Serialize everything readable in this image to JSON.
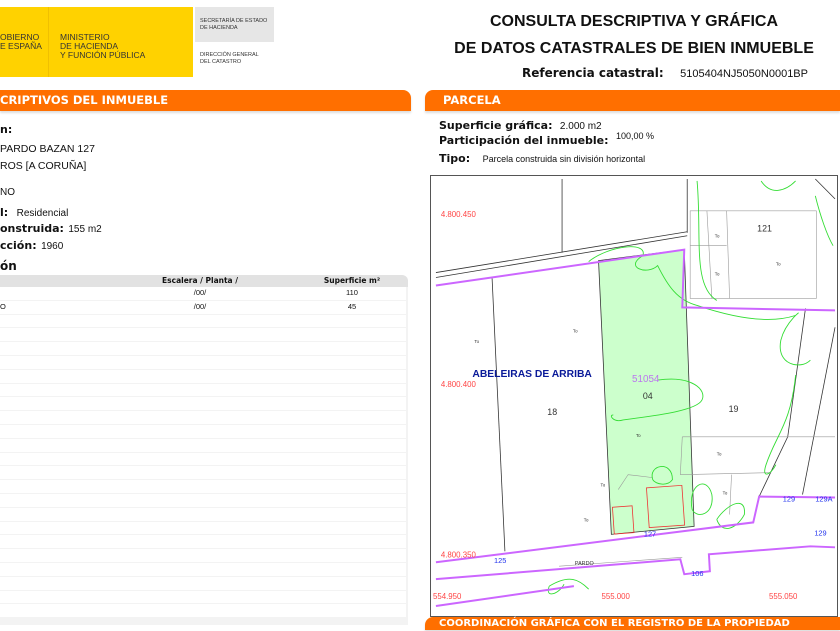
{
  "header": {
    "gov_line1": "OBIERNO",
    "gov_line2": "E ESPAÑA",
    "ministry_line1": "MINISTERIO",
    "ministry_line2": "DE HACIENDA",
    "ministry_line3": "Y FUNCIÓN PÚBLICA",
    "secretaria_line1": "SECRETARÍA DE ESTADO",
    "secretaria_line2": "DE HACIENDA",
    "direccion_line1": "DIRECCIÓN GENERAL",
    "direccion_line2": "DEL CATASTRO",
    "title_line1": "CONSULTA DESCRIPTIVA Y GRÁFICA",
    "title_line2": "DE DATOS CATASTRALES DE BIEN INMUEBLE",
    "ref_label": "Referencia catastral:",
    "ref_value": "5105404NJ5050N0001BP"
  },
  "left": {
    "section_title": "CRIPTIVOS DEL INMUEBLE",
    "loc_label": "n:",
    "address1": "PARDO BAZAN 127",
    "address2": "ROS [A CORUÑA]",
    "clase": "NO",
    "uso_label": "l:",
    "uso_value": "Residencial",
    "sup_label": "onstruida:",
    "sup_value": "155 m2",
    "anio_label": "cción:",
    "anio_value": "1960",
    "const_label": "ón",
    "table": {
      "headers": [
        "",
        "Escalera / Planta / Puerta",
        "Superficie m²"
      ],
      "rows": [
        [
          "",
          "/00/",
          "110"
        ],
        [
          "O",
          "/00/",
          "45"
        ]
      ]
    }
  },
  "right": {
    "section_title": "PARCELA",
    "sup_label": "Superficie gráfica:",
    "sup_value": "2.000 m2",
    "part_label": "Participación del inmueble:",
    "part_value": "100,00 %",
    "tipo_label": "Tipo:",
    "tipo_value": "Parcela construida sin división horizontal",
    "map": {
      "y_coords": [
        "4.800.450",
        "4.800.400",
        "4.800.350"
      ],
      "x_coords": [
        "554.950",
        "555.000",
        "555.050"
      ],
      "place": "ABELEIRAS DE ARRIBA",
      "parcel_ref": "51054",
      "parcel_num": "04",
      "parcels": [
        "121",
        "18",
        "19"
      ],
      "house_numbers": [
        "129",
        "129A",
        "129",
        "127",
        "125",
        "106"
      ],
      "street": "PARDO",
      "to_label": "To"
    },
    "next_section": "COORDINACIÓN GRÁFICA CON EL REGISTRO DE LA PROPIEDAD"
  },
  "colors": {
    "orange": "#ff6f00",
    "yellow": "#ffd200",
    "parcel": "#ccffcc",
    "boundary": "#cc66ff",
    "contour": "#33dd33"
  }
}
